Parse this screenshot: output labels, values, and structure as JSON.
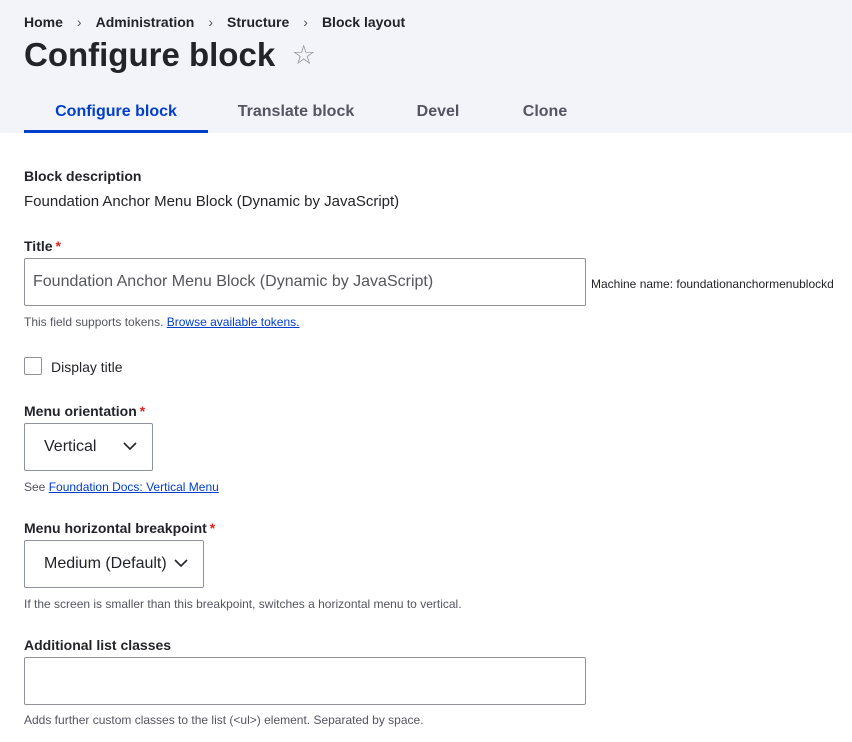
{
  "breadcrumb": {
    "items": [
      "Home",
      "Administration",
      "Structure",
      "Block layout"
    ],
    "separator": "›"
  },
  "page": {
    "title": "Configure block",
    "star_icon": "☆"
  },
  "tabs": [
    {
      "label": "Configure block",
      "active": true
    },
    {
      "label": "Translate block",
      "active": false
    },
    {
      "label": "Devel",
      "active": false
    },
    {
      "label": "Clone",
      "active": false
    }
  ],
  "form": {
    "block_description": {
      "label": "Block description",
      "value": "Foundation Anchor Menu Block (Dynamic by JavaScript)"
    },
    "title": {
      "label": "Title",
      "required_mark": "*",
      "value": "Foundation Anchor Menu Block (Dynamic by JavaScript)",
      "machine_name": "Machine name: foundationanchormenublockd",
      "help_prefix": "This field supports tokens.",
      "help_link": "Browse available tokens."
    },
    "display_title": {
      "label": "Display title",
      "checked": false
    },
    "menu_orientation": {
      "label": "Menu orientation",
      "required_mark": "*",
      "selected": "Vertical",
      "help_prefix": "See",
      "help_link": "Foundation Docs: Vertical Menu"
    },
    "menu_breakpoint": {
      "label": "Menu horizontal breakpoint",
      "required_mark": "*",
      "selected": "Medium (Default)",
      "help": "If the screen is smaller than this breakpoint, switches a horizontal menu to vertical."
    },
    "additional_classes": {
      "label": "Additional list classes",
      "value": "",
      "help": "Adds further custom classes to the list (<ul>) element. Separated by space."
    }
  },
  "colors": {
    "accent": "#003ecc",
    "required": "#dc2323",
    "header_bg": "#f3f4f9"
  }
}
